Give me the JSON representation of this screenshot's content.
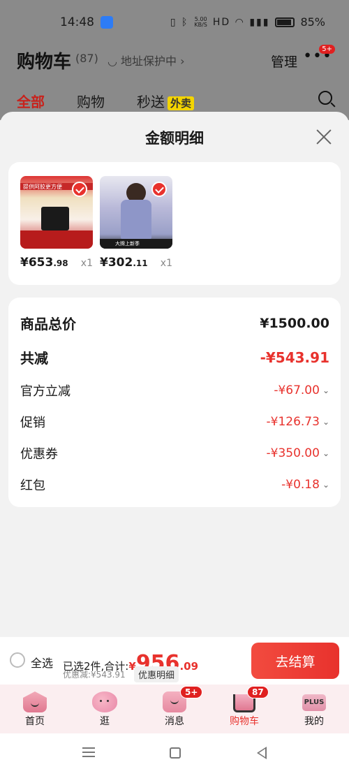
{
  "status_bar": {
    "time": "14:48",
    "speed_value": "5.00",
    "speed_unit": "KB/S",
    "battery_text": "85%"
  },
  "header": {
    "title": "购物车",
    "count": "(87)",
    "address_protect": "地址保护中",
    "manage": "管理",
    "more_badge": "5+"
  },
  "tabs": [
    {
      "label": "全部"
    },
    {
      "label": "购物"
    },
    {
      "label": "秒送",
      "tag": "外卖"
    }
  ],
  "sheet": {
    "title": "金额明细",
    "products": [
      {
        "price_int": "¥653",
        "price_dec": ".98",
        "qty": "x1",
        "image_text": "提供阿胶更方便"
      },
      {
        "price_int": "¥302",
        "price_dec": ".11",
        "qty": "x1",
        "image_text": "大牌上新季"
      }
    ],
    "summary": [
      {
        "label": "商品总价",
        "value": "¥1500.00"
      },
      {
        "label": "共减",
        "value": "-¥543.91"
      }
    ],
    "details": [
      {
        "label": "官方立减",
        "value": "-¥67.00"
      },
      {
        "label": "促销",
        "value": "-¥126.73"
      },
      {
        "label": "优惠券",
        "value": "-¥350.00"
      },
      {
        "label": "红包",
        "value": "-¥0.18"
      }
    ]
  },
  "checkout": {
    "select_all": "全选",
    "selected_prefix": "已选2件,合计:",
    "total_yen": "¥",
    "total_int": "956",
    "total_dec": ".09",
    "discount": "优惠减:¥543.91",
    "detail_button": "优惠明细",
    "checkout_button": "去结算"
  },
  "tabbar": [
    {
      "label": "首页",
      "icon": "home-icon"
    },
    {
      "label": "逛",
      "icon": "stroll-icon"
    },
    {
      "label": "消息",
      "icon": "message-icon",
      "badge": "5+"
    },
    {
      "label": "购物车",
      "icon": "cart-icon",
      "badge": "87",
      "active": true
    },
    {
      "label": "我的",
      "icon": "plus-icon",
      "icon_text": "PLUS"
    }
  ]
}
